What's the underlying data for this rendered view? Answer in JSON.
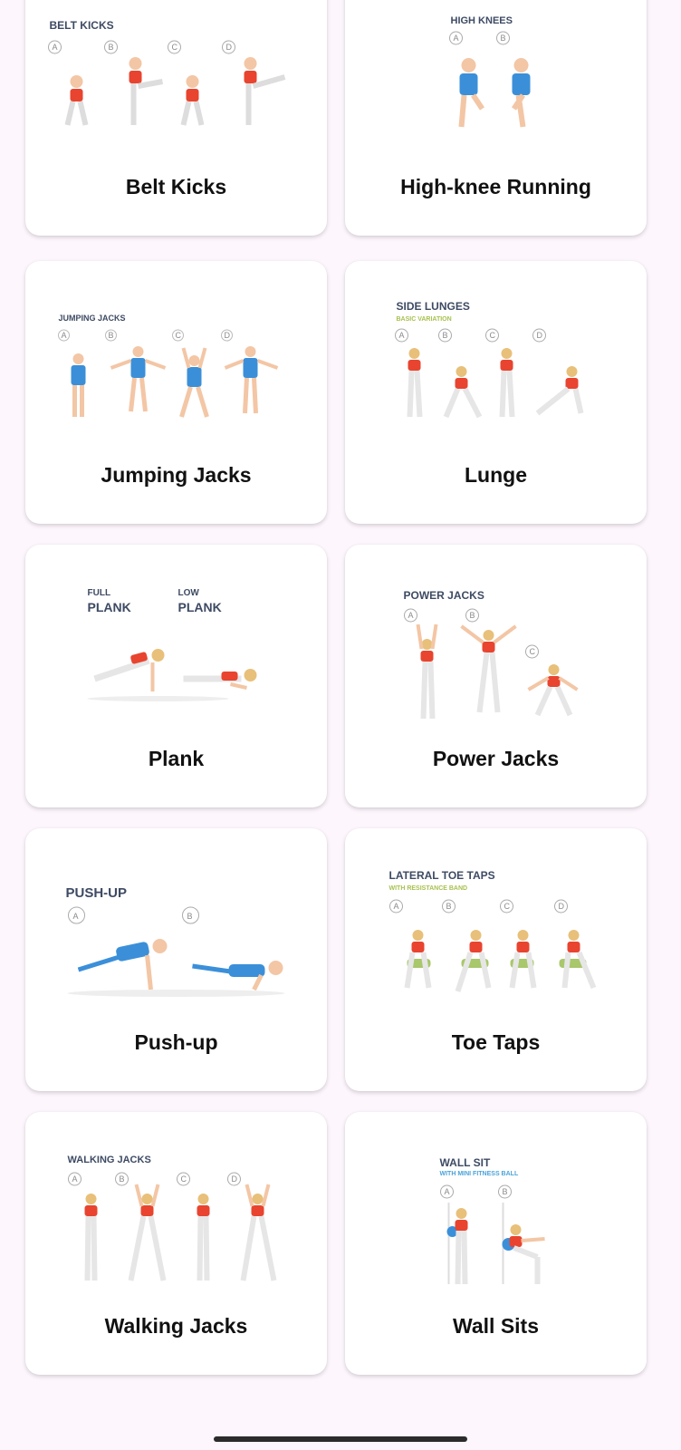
{
  "exercises": [
    {
      "title": "Belt Kicks",
      "image_title": "BELT KICKS",
      "image_subtitle": "",
      "steps": [
        "A",
        "B",
        "C",
        "D"
      ]
    },
    {
      "title": "High-knee Running",
      "image_title": "HIGH KNEES",
      "image_subtitle": "",
      "steps": [
        "A",
        "B"
      ]
    },
    {
      "title": "Jumping Jacks",
      "image_title": "JUMPING JACKS",
      "image_subtitle": "",
      "steps": [
        "A",
        "B",
        "C",
        "D"
      ]
    },
    {
      "title": "Lunge",
      "image_title": "SIDE LUNGES",
      "image_subtitle": "BASIC VARIATION",
      "steps": [
        "A",
        "B",
        "C",
        "D"
      ]
    },
    {
      "title": "Plank",
      "image_title": "FULL",
      "image_title_2": "PLANK",
      "image_title_3": "LOW",
      "image_title_4": "PLANK",
      "steps": []
    },
    {
      "title": "Power Jacks",
      "image_title": "POWER JACKS",
      "image_subtitle": "",
      "steps": [
        "A",
        "B",
        "C"
      ]
    },
    {
      "title": "Push-up",
      "image_title": "PUSH-UP",
      "image_subtitle": "",
      "steps": [
        "A",
        "B"
      ]
    },
    {
      "title": "Toe Taps",
      "image_title": "LATERAL TOE TAPS",
      "image_subtitle": "WITH RESISTANCE BAND",
      "steps": [
        "A",
        "B",
        "C",
        "D"
      ]
    },
    {
      "title": "Walking Jacks",
      "image_title": "WALKING JACKS",
      "image_subtitle": "",
      "steps": [
        "A",
        "B",
        "C",
        "D"
      ]
    },
    {
      "title": "Wall Sits",
      "image_title": "WALL SIT",
      "image_subtitle": "WITH MINI FITNESS BALL",
      "steps": [
        "A",
        "B"
      ]
    }
  ],
  "colors": {
    "background": "#fdf6fd",
    "card": "#ffffff",
    "title_text": "#111111",
    "illustration_title": "#3d4a63",
    "female_top": "#e8442f",
    "male_shirt": "#3b8fd9",
    "skin": "#f3c6a5",
    "hair_blonde": "#e8c07a",
    "band_green": "#a9c76b",
    "sub_green": "#a6c14f",
    "sub_blue": "#4aa3d8"
  }
}
